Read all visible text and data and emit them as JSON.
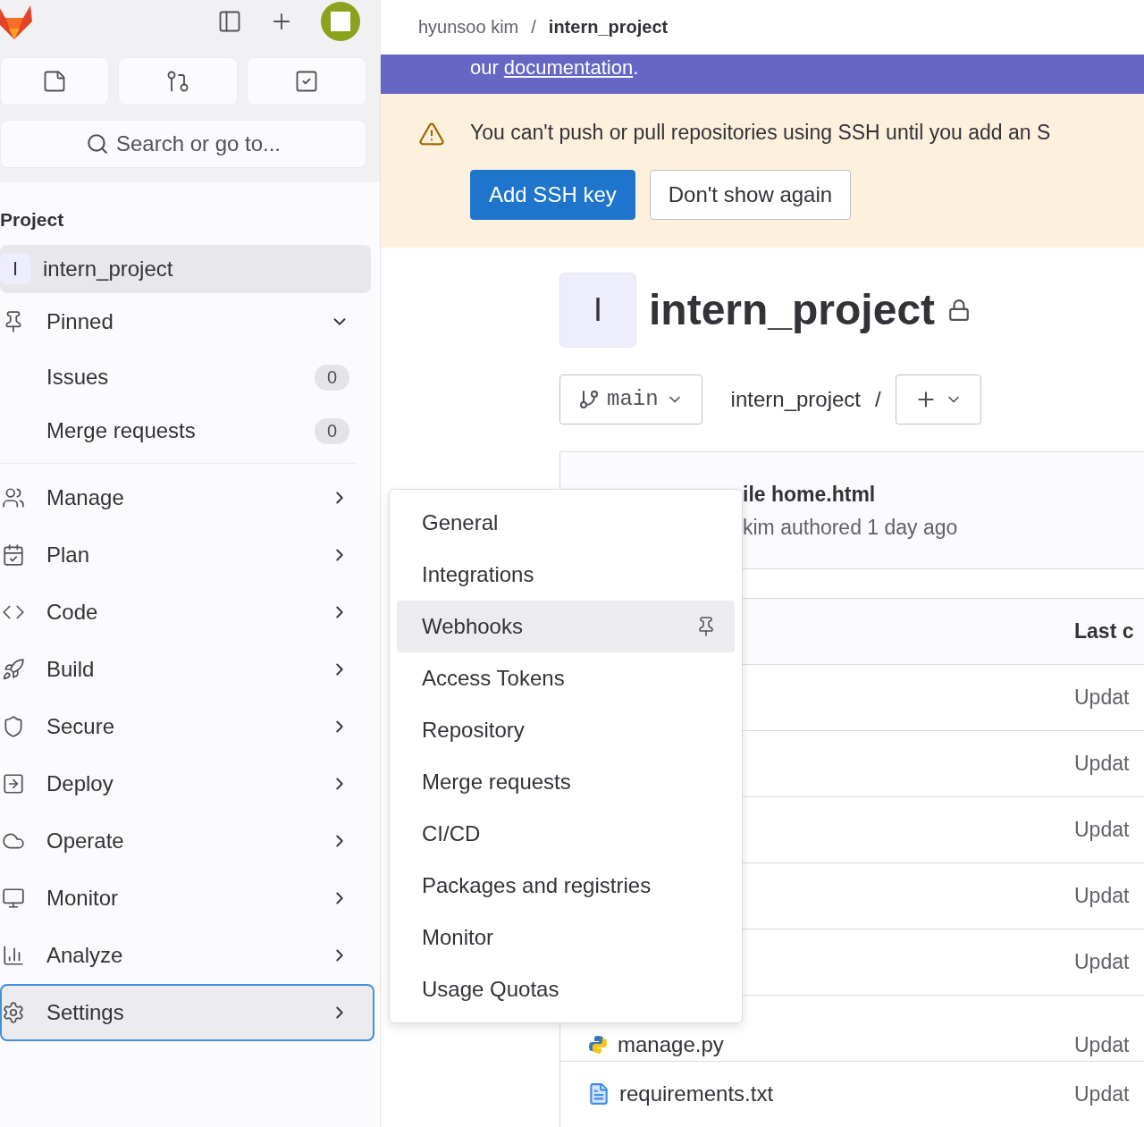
{
  "sidebar": {
    "search": {
      "placeholder": "Search or go to..."
    },
    "section_title": "Project",
    "items": [
      {
        "kind": "project",
        "letter": "I",
        "label": "intern_project",
        "selected": true
      },
      {
        "kind": "group",
        "label": "Pinned",
        "expanded": true,
        "children": [
          {
            "label": "Issues",
            "count": "0"
          },
          {
            "label": "Merge requests",
            "count": "0"
          }
        ]
      },
      {
        "kind": "nav",
        "label": "Manage",
        "selected": false
      },
      {
        "kind": "nav",
        "label": "Plan",
        "selected": false
      },
      {
        "kind": "nav",
        "label": "Code",
        "selected": false
      },
      {
        "kind": "nav",
        "label": "Build",
        "selected": false
      },
      {
        "kind": "nav",
        "label": "Secure",
        "selected": false
      },
      {
        "kind": "nav",
        "label": "Deploy",
        "selected": false
      },
      {
        "kind": "nav",
        "label": "Operate",
        "selected": false
      },
      {
        "kind": "nav",
        "label": "Monitor",
        "selected": false
      },
      {
        "kind": "nav",
        "label": "Analyze",
        "selected": false
      },
      {
        "kind": "nav",
        "label": "Settings",
        "selected": true
      }
    ]
  },
  "breadcrumb": {
    "items": [
      "hyunsoo kim",
      "intern_project"
    ],
    "separator": "/"
  },
  "banner": {
    "prefix": "our",
    "link": "documentation",
    "suffix": "."
  },
  "alert": {
    "message": "You can't push or pull repositories using SSH until you add an S",
    "buttons": [
      "Add SSH key",
      "Don't show again"
    ]
  },
  "project": {
    "avatar_letter": "I",
    "name": "intern_project",
    "private": true
  },
  "repo_bar": {
    "branch": "main",
    "path": "intern_project",
    "separator": "/"
  },
  "commit": {
    "title": "ile home.html",
    "meta": "kim authored 1 day ago"
  },
  "table": {
    "column_3": "Last c",
    "rows": [
      {
        "column_3": "Updat"
      },
      {
        "column_3": "Updat"
      },
      {
        "column_3": "Updat"
      },
      {
        "column_3": "Updat"
      },
      {
        "column_3": "Updat"
      },
      {
        "name": "manage.py",
        "column_3": "Updat"
      },
      {
        "name": "requirements.txt",
        "column_3": "Updat"
      }
    ]
  },
  "settings_menu": {
    "items": [
      {
        "label": "General",
        "selected": false
      },
      {
        "label": "Integrations",
        "selected": false
      },
      {
        "label": "Webhooks",
        "selected": true
      },
      {
        "label": "Access Tokens",
        "selected": false
      },
      {
        "label": "Repository",
        "selected": false
      },
      {
        "label": "Merge requests",
        "selected": false
      },
      {
        "label": "CI/CD",
        "selected": false
      },
      {
        "label": "Packages and registries",
        "selected": false
      },
      {
        "label": "Monitor",
        "selected": false
      },
      {
        "label": "Usage Quotas",
        "selected": false
      }
    ]
  }
}
